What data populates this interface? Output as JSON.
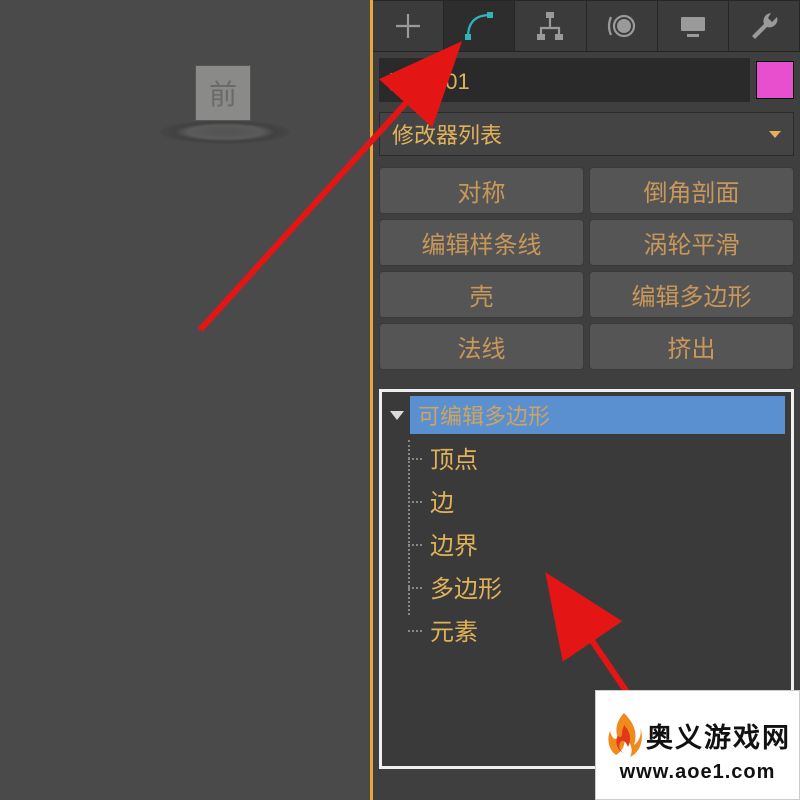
{
  "viewport": {
    "cube_label": "前"
  },
  "panel": {
    "object_name": "对象001",
    "modifier_list_label": "修改器列表",
    "buttons": {
      "b0": "对称",
      "b1": "倒角剖面",
      "b2": "编辑样条线",
      "b3": "涡轮平滑",
      "b4": "壳",
      "b5": "编辑多边形",
      "b6": "法线",
      "b7": "挤出"
    },
    "stack": {
      "root": "可编辑多边形",
      "children": {
        "c0": "顶点",
        "c1": "边",
        "c2": "边界",
        "c3": "多边形",
        "c4": "元素"
      }
    },
    "color_swatch": "#e84fcf"
  },
  "watermark": {
    "name": "奥义游戏网",
    "url": "www.aoe1.com"
  }
}
